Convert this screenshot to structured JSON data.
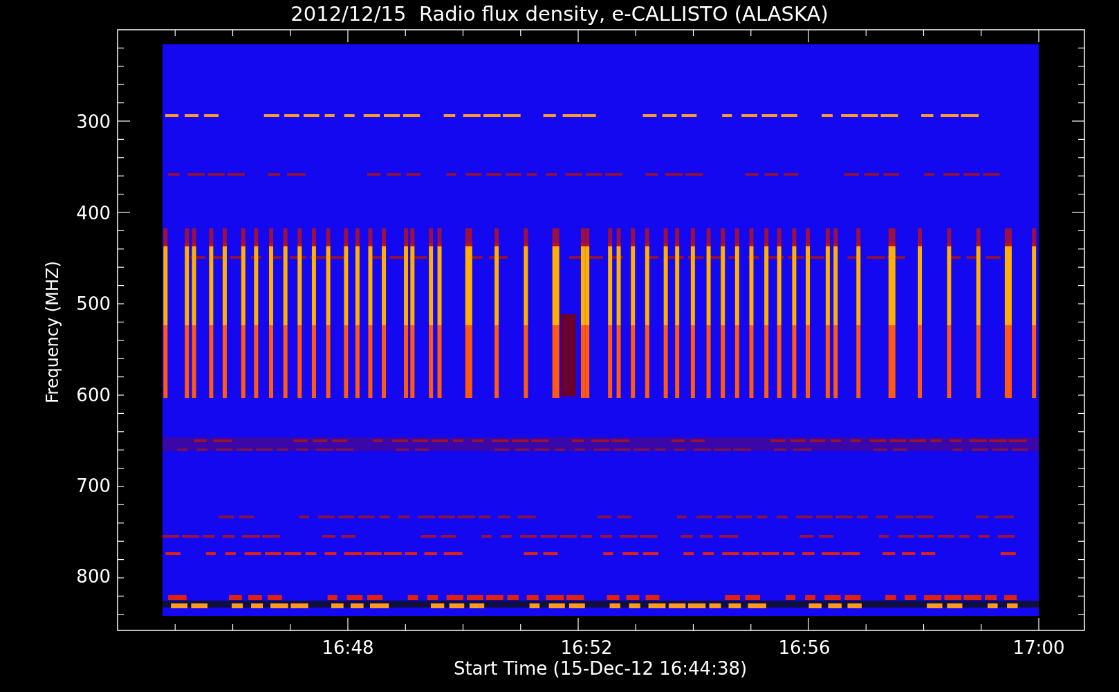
{
  "title": "2012/12/15  Radio flux density, e-CALLISTO (ALASKA)",
  "y_axis": {
    "label": "Frequency (MHZ)",
    "ticks": [
      "300",
      "400",
      "500",
      "600",
      "700",
      "800"
    ]
  },
  "x_axis": {
    "label": "Start Time (15-Dec-12 16:44:38)",
    "ticks": [
      "16:48",
      "16:52",
      "16:56",
      "17:00"
    ]
  }
}
